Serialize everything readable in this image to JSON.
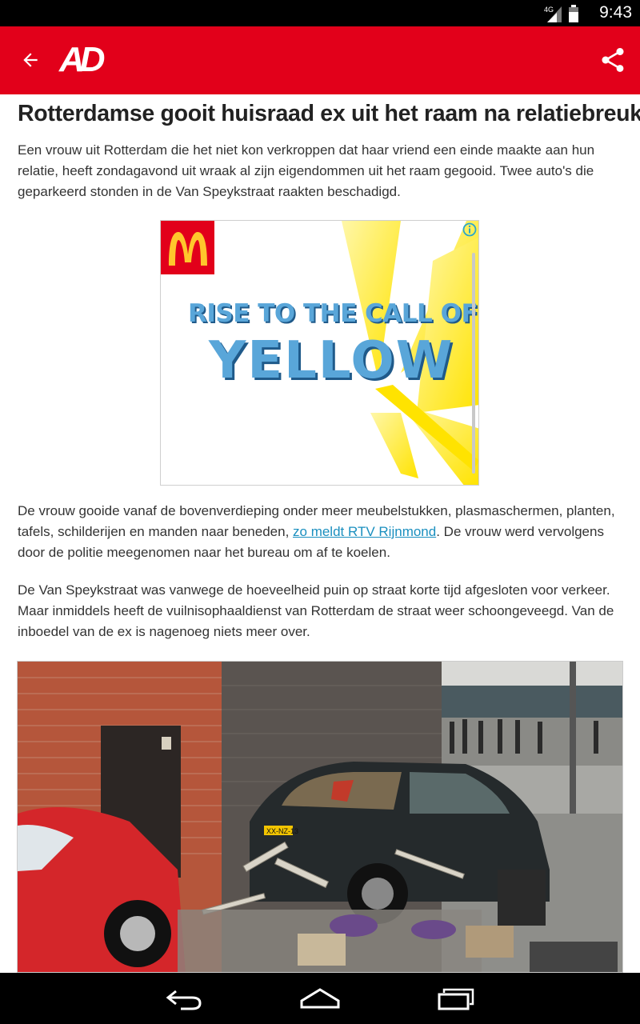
{
  "status_bar": {
    "time": "9:43",
    "network": "4G",
    "icons": [
      "signal-icon",
      "battery-icon"
    ]
  },
  "app_bar": {
    "logo": "AD",
    "back_icon": "arrow-back-icon",
    "share_icon": "share-icon",
    "color": "#e2001a"
  },
  "article": {
    "headline": "Rotterdamse gooit huisraad ex uit het raam na relatiebreuk",
    "intro": "Een vrouw uit Rotterdam die het niet kon verkroppen dat haar vriend een einde maakte aan hun relatie, heeft zondagavond uit wraak al zijn eigendommen uit het raam gegooid. Twee auto's die geparkeerd stonden in de Van Speykstraat raakten beschadigd.",
    "paragraph2_before": "De vrouw gooide vanaf de bovenverdieping onder meer meubelstukken, plasmaschermen, planten, tafels, schilderijen en manden naar beneden, ",
    "paragraph2_link": "zo meldt RTV Rijnmond",
    "paragraph2_after": ". De vrouw werd vervolgens door de politie meegenomen naar het bureau om af te koelen.",
    "paragraph3": "De Van Speykstraat was vanwege de hoeveelheid puin op straat korte tijd afgesloten voor verkeer. Maar inmiddels heeft de vuilnisophaaldienst van Rotterdam de straat weer schoongeveegd. Van de inboedel van de ex is nagenoeg niets meer over.",
    "photo_plate": "XX-NZ-13",
    "link_color": "#1a8fbf"
  },
  "ad": {
    "line1": "RISE TO THE CALL OF",
    "line2": "YELLOW",
    "brand_icon": "mcdonalds-logo-icon",
    "info_icon": "info-icon"
  },
  "nav_bar": {
    "buttons": [
      "back-nav-icon",
      "home-nav-icon",
      "recents-nav-icon"
    ]
  }
}
